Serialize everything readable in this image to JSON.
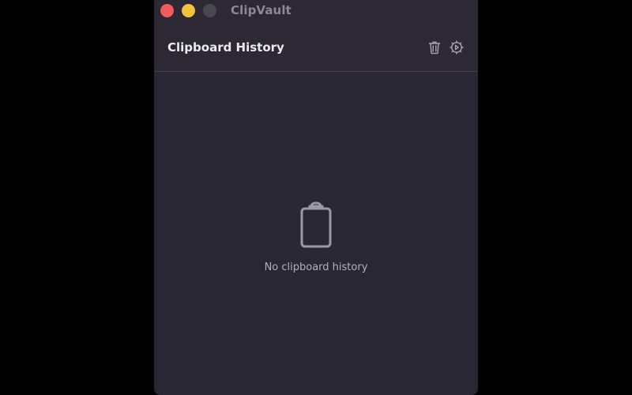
{
  "window": {
    "title": "ClipVault"
  },
  "header": {
    "title": "Clipboard History"
  },
  "empty_state": {
    "message": "No clipboard history",
    "icon": "clipboard-icon"
  },
  "icons": {
    "clear": "trash-icon",
    "settings": "gear-icon"
  },
  "colors": {
    "background": "#2a2734",
    "close": "#ee5d5b",
    "minimize": "#f3c13e",
    "zoom_inactive": "#4a4753"
  }
}
